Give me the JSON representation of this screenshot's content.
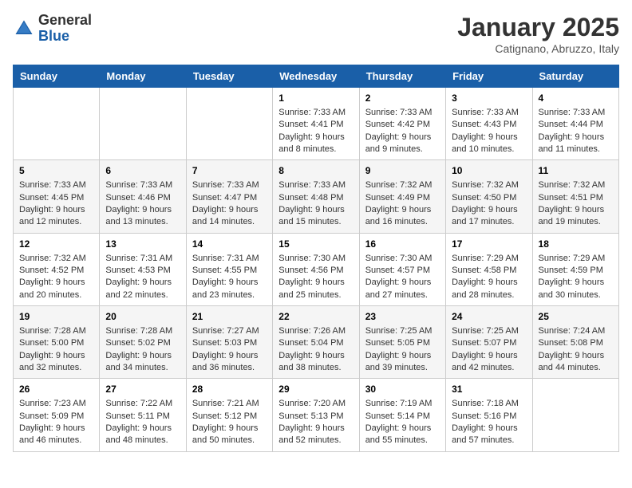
{
  "logo": {
    "general": "General",
    "blue": "Blue"
  },
  "title": "January 2025",
  "location": "Catignano, Abruzzo, Italy",
  "days_of_week": [
    "Sunday",
    "Monday",
    "Tuesday",
    "Wednesday",
    "Thursday",
    "Friday",
    "Saturday"
  ],
  "weeks": [
    [
      null,
      null,
      null,
      {
        "day": 1,
        "sunrise": "7:33 AM",
        "sunset": "4:41 PM",
        "daylight": "9 hours and 8 minutes."
      },
      {
        "day": 2,
        "sunrise": "7:33 AM",
        "sunset": "4:42 PM",
        "daylight": "9 hours and 9 minutes."
      },
      {
        "day": 3,
        "sunrise": "7:33 AM",
        "sunset": "4:43 PM",
        "daylight": "9 hours and 10 minutes."
      },
      {
        "day": 4,
        "sunrise": "7:33 AM",
        "sunset": "4:44 PM",
        "daylight": "9 hours and 11 minutes."
      }
    ],
    [
      {
        "day": 5,
        "sunrise": "7:33 AM",
        "sunset": "4:45 PM",
        "daylight": "9 hours and 12 minutes."
      },
      {
        "day": 6,
        "sunrise": "7:33 AM",
        "sunset": "4:46 PM",
        "daylight": "9 hours and 13 minutes."
      },
      {
        "day": 7,
        "sunrise": "7:33 AM",
        "sunset": "4:47 PM",
        "daylight": "9 hours and 14 minutes."
      },
      {
        "day": 8,
        "sunrise": "7:33 AM",
        "sunset": "4:48 PM",
        "daylight": "9 hours and 15 minutes."
      },
      {
        "day": 9,
        "sunrise": "7:32 AM",
        "sunset": "4:49 PM",
        "daylight": "9 hours and 16 minutes."
      },
      {
        "day": 10,
        "sunrise": "7:32 AM",
        "sunset": "4:50 PM",
        "daylight": "9 hours and 17 minutes."
      },
      {
        "day": 11,
        "sunrise": "7:32 AM",
        "sunset": "4:51 PM",
        "daylight": "9 hours and 19 minutes."
      }
    ],
    [
      {
        "day": 12,
        "sunrise": "7:32 AM",
        "sunset": "4:52 PM",
        "daylight": "9 hours and 20 minutes."
      },
      {
        "day": 13,
        "sunrise": "7:31 AM",
        "sunset": "4:53 PM",
        "daylight": "9 hours and 22 minutes."
      },
      {
        "day": 14,
        "sunrise": "7:31 AM",
        "sunset": "4:55 PM",
        "daylight": "9 hours and 23 minutes."
      },
      {
        "day": 15,
        "sunrise": "7:30 AM",
        "sunset": "4:56 PM",
        "daylight": "9 hours and 25 minutes."
      },
      {
        "day": 16,
        "sunrise": "7:30 AM",
        "sunset": "4:57 PM",
        "daylight": "9 hours and 27 minutes."
      },
      {
        "day": 17,
        "sunrise": "7:29 AM",
        "sunset": "4:58 PM",
        "daylight": "9 hours and 28 minutes."
      },
      {
        "day": 18,
        "sunrise": "7:29 AM",
        "sunset": "4:59 PM",
        "daylight": "9 hours and 30 minutes."
      }
    ],
    [
      {
        "day": 19,
        "sunrise": "7:28 AM",
        "sunset": "5:00 PM",
        "daylight": "9 hours and 32 minutes."
      },
      {
        "day": 20,
        "sunrise": "7:28 AM",
        "sunset": "5:02 PM",
        "daylight": "9 hours and 34 minutes."
      },
      {
        "day": 21,
        "sunrise": "7:27 AM",
        "sunset": "5:03 PM",
        "daylight": "9 hours and 36 minutes."
      },
      {
        "day": 22,
        "sunrise": "7:26 AM",
        "sunset": "5:04 PM",
        "daylight": "9 hours and 38 minutes."
      },
      {
        "day": 23,
        "sunrise": "7:25 AM",
        "sunset": "5:05 PM",
        "daylight": "9 hours and 39 minutes."
      },
      {
        "day": 24,
        "sunrise": "7:25 AM",
        "sunset": "5:07 PM",
        "daylight": "9 hours and 42 minutes."
      },
      {
        "day": 25,
        "sunrise": "7:24 AM",
        "sunset": "5:08 PM",
        "daylight": "9 hours and 44 minutes."
      }
    ],
    [
      {
        "day": 26,
        "sunrise": "7:23 AM",
        "sunset": "5:09 PM",
        "daylight": "9 hours and 46 minutes."
      },
      {
        "day": 27,
        "sunrise": "7:22 AM",
        "sunset": "5:11 PM",
        "daylight": "9 hours and 48 minutes."
      },
      {
        "day": 28,
        "sunrise": "7:21 AM",
        "sunset": "5:12 PM",
        "daylight": "9 hours and 50 minutes."
      },
      {
        "day": 29,
        "sunrise": "7:20 AM",
        "sunset": "5:13 PM",
        "daylight": "9 hours and 52 minutes."
      },
      {
        "day": 30,
        "sunrise": "7:19 AM",
        "sunset": "5:14 PM",
        "daylight": "9 hours and 55 minutes."
      },
      {
        "day": 31,
        "sunrise": "7:18 AM",
        "sunset": "5:16 PM",
        "daylight": "9 hours and 57 minutes."
      },
      null
    ]
  ]
}
